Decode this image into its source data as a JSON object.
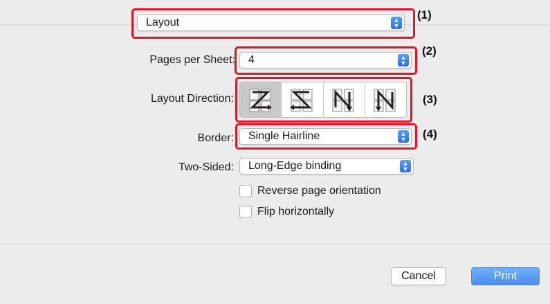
{
  "panel": {
    "popup": {
      "value": "Layout"
    },
    "pages_per_sheet": {
      "label": "Pages per Sheet:",
      "value": "4"
    },
    "layout_direction": {
      "label": "Layout Direction:",
      "options": [
        "Z",
        "S",
        "И",
        "N"
      ],
      "selected": 0
    },
    "border": {
      "label": "Border:",
      "value": "Single Hairline"
    },
    "two_sided": {
      "label": "Two-Sided:",
      "value": "Long-Edge binding"
    },
    "reverse": {
      "label": "Reverse page orientation",
      "checked": false
    },
    "flip": {
      "label": "Flip horizontally",
      "checked": false
    }
  },
  "callouts": {
    "c1": "(1)",
    "c2": "(2)",
    "c3": "(3)",
    "c4": "(4)"
  },
  "buttons": {
    "cancel": "Cancel",
    "print": "Print"
  },
  "colors": {
    "highlight": "#e1142a",
    "accent": "#3c82ee"
  }
}
